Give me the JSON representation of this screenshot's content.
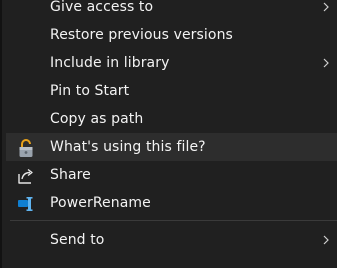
{
  "context_menu": {
    "items": [
      {
        "label": "Give access to",
        "has_submenu": true,
        "icon": null
      },
      {
        "label": "Restore previous versions",
        "has_submenu": false,
        "icon": null
      },
      {
        "label": "Include in library",
        "has_submenu": true,
        "icon": null
      },
      {
        "label": "Pin to Start",
        "has_submenu": false,
        "icon": null
      },
      {
        "label": "Copy as path",
        "has_submenu": false,
        "icon": null
      },
      {
        "label": "What's using this file?",
        "has_submenu": false,
        "icon": "padlock-icon"
      },
      {
        "label": "Share",
        "has_submenu": false,
        "icon": "share-icon"
      },
      {
        "label": "PowerRename",
        "has_submenu": false,
        "icon": "powerrename-icon"
      },
      {
        "label": "Send to",
        "has_submenu": true,
        "icon": null
      }
    ]
  },
  "colors": {
    "menu_background": "#202020",
    "hover_background": "#2d2d2d",
    "text": "#f3f3f3",
    "separator": "#3a3a3a",
    "padlock_accent": "#e8a21b",
    "powerrename_accent": "#0f7fd1"
  }
}
